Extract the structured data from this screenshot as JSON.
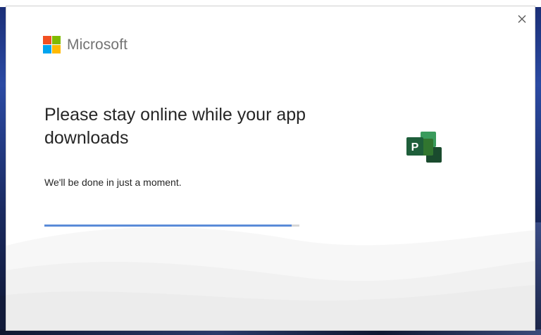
{
  "brand": {
    "name": "Microsoft",
    "logo_colors": [
      "#f25022",
      "#7fba00",
      "#00a4ef",
      "#ffb900"
    ]
  },
  "dialog": {
    "headline": "Please stay online while your app downloads",
    "subtext": "We'll be done in just a moment.",
    "progress": 0.97,
    "progress_color": "#5a8bd8",
    "close_icon": "close-icon"
  },
  "app_icon": {
    "name": "project-icon",
    "letter": "P",
    "colors": [
      "#1e5e3a",
      "#31752f",
      "#3a9b5c",
      "#1a4b2e"
    ]
  }
}
